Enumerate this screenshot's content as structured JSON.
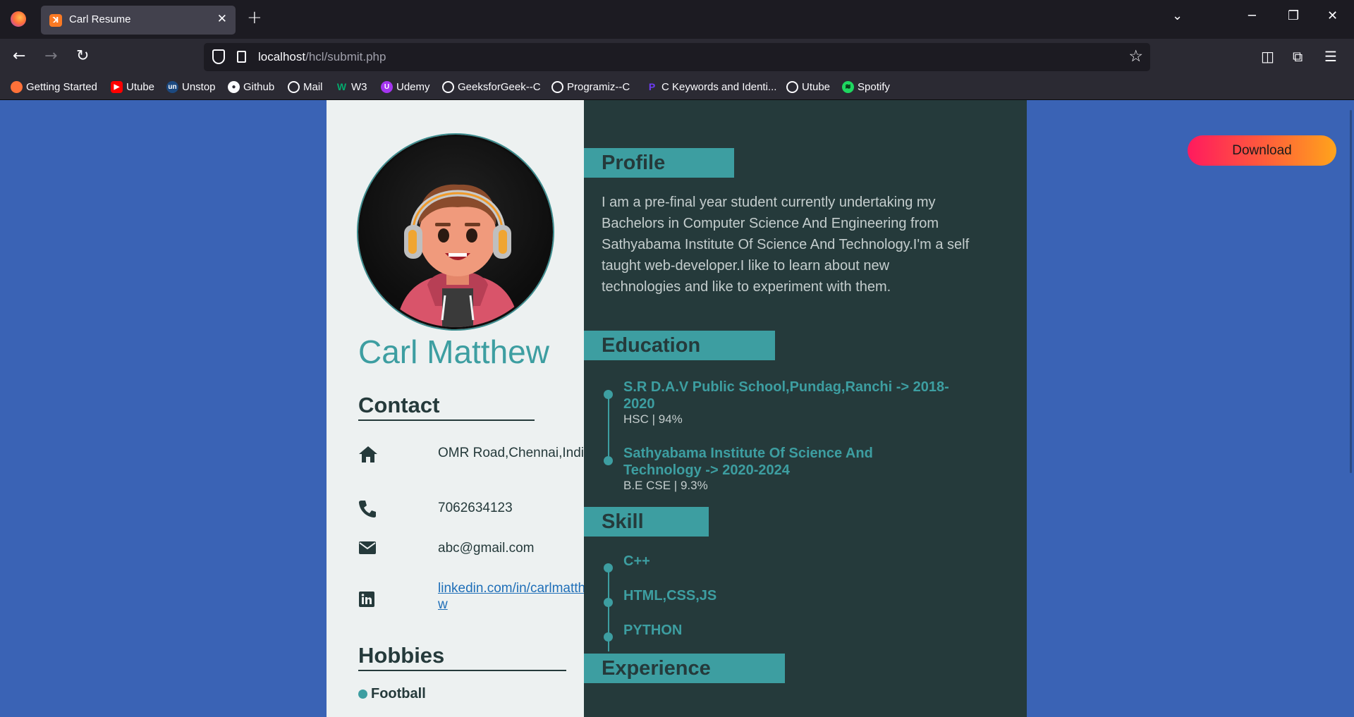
{
  "browser": {
    "tab_title": "Carl Resume",
    "url_host": "localhost",
    "url_path": "/hcl/submit.php",
    "bookmarks": [
      "Getting Started",
      "Utube",
      "Unstop",
      "Github",
      "Mail",
      "W3",
      "Udemy",
      "GeeksforGeek--C",
      "Programiz--C",
      "C Keywords and Identi...",
      "Utube",
      "Spotify"
    ]
  },
  "sidebar": {
    "name": "Carl Matthew",
    "contact_heading": "Contact",
    "contacts": [
      {
        "icon": "home-icon",
        "text": "OMR Road,Chennai,India"
      },
      {
        "icon": "phone-icon",
        "text": "7062634123"
      },
      {
        "icon": "envelope-icon",
        "text": "abc@gmail.com"
      },
      {
        "icon": "linkedin-icon",
        "text": "linkedin.com/in/carlmatthew"
      }
    ],
    "hobbies_heading": "Hobbies",
    "hobbies": [
      "Football"
    ]
  },
  "main": {
    "profile_heading": "Profile",
    "profile_text": "I am a pre-final year student currently undertaking my Bachelors in Computer Science And Engineering from Sathyabama Institute Of Science And Technology.I'm a self taught web-developer.I like to learn about new technologies and like to experiment with them.",
    "education_heading": "Education",
    "education": [
      {
        "title": "S.R D.A.V Public School,Pundag,Ranchi -> 2018-2020",
        "sub": "HSC | 94%"
      },
      {
        "title": "Sathyabama Institute Of Science And Technology -> 2020-2024",
        "sub": "B.E CSE | 9.3%"
      }
    ],
    "skill_heading": "Skill",
    "skills": [
      "C++",
      "HTML,CSS,JS",
      "PYTHON"
    ],
    "experience_heading": "Experience"
  },
  "download_label": "Download",
  "colors": {
    "accent": "#3d9ea1",
    "dark": "#253a3b",
    "sidebar_bg": "#edf1f1",
    "page_bg": "#3a63b5"
  }
}
